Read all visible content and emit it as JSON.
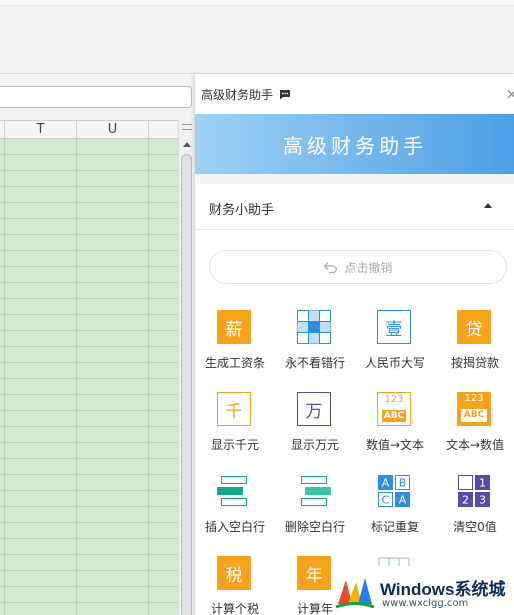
{
  "spreadsheet": {
    "columns": [
      "",
      "T",
      "U",
      ""
    ]
  },
  "pane": {
    "title": "高级财务助手",
    "close": "×",
    "banner_title": "高级财务助手",
    "section_label": "财务小助手",
    "undo_label": "点击撤销",
    "tools": [
      {
        "label": "生成工资条",
        "icon": "salary-icon",
        "glyph": "薪"
      },
      {
        "label": "永不看错行",
        "icon": "grid-highlight-icon"
      },
      {
        "label": "人民币大写",
        "icon": "rmb-uppercase-icon",
        "glyph": "壹"
      },
      {
        "label": "按揭贷款",
        "icon": "loan-icon",
        "glyph": "贷"
      },
      {
        "label": "显示千元",
        "icon": "thousand-icon",
        "glyph": "千"
      },
      {
        "label": "显示万元",
        "icon": "ten-thousand-icon",
        "glyph": "万"
      },
      {
        "label": "数值→文本",
        "icon": "number-to-text-icon",
        "num": "123",
        "abc": "ABC"
      },
      {
        "label": "文本→数值",
        "icon": "text-to-number-icon",
        "num": "123",
        "abc": "ABC"
      },
      {
        "label": "插入空白行",
        "icon": "insert-blank-row-icon"
      },
      {
        "label": "删除空白行",
        "icon": "delete-blank-row-icon"
      },
      {
        "label": "标记重复",
        "icon": "mark-duplicates-icon",
        "letters": [
          "A",
          "B",
          "C",
          "A"
        ]
      },
      {
        "label": "清空0值",
        "icon": "clear-zero-icon",
        "digits": [
          "1",
          "2",
          "3"
        ]
      },
      {
        "label": "计算个税",
        "icon": "tax-icon",
        "glyph": "税"
      },
      {
        "label": "计算年",
        "icon": "year-icon",
        "glyph": "年"
      }
    ]
  },
  "watermark": {
    "title": "Windows系统城",
    "url": "www.wxclgg.com"
  },
  "colors": {
    "orange": "#f7a21b",
    "blue": "#2d8ee0",
    "purple": "#5b4aa8",
    "teal": "#19a78a",
    "banner_start": "#9ed0f4",
    "banner_end": "#4b9fe6",
    "grid_fill": "#d2ead3"
  }
}
